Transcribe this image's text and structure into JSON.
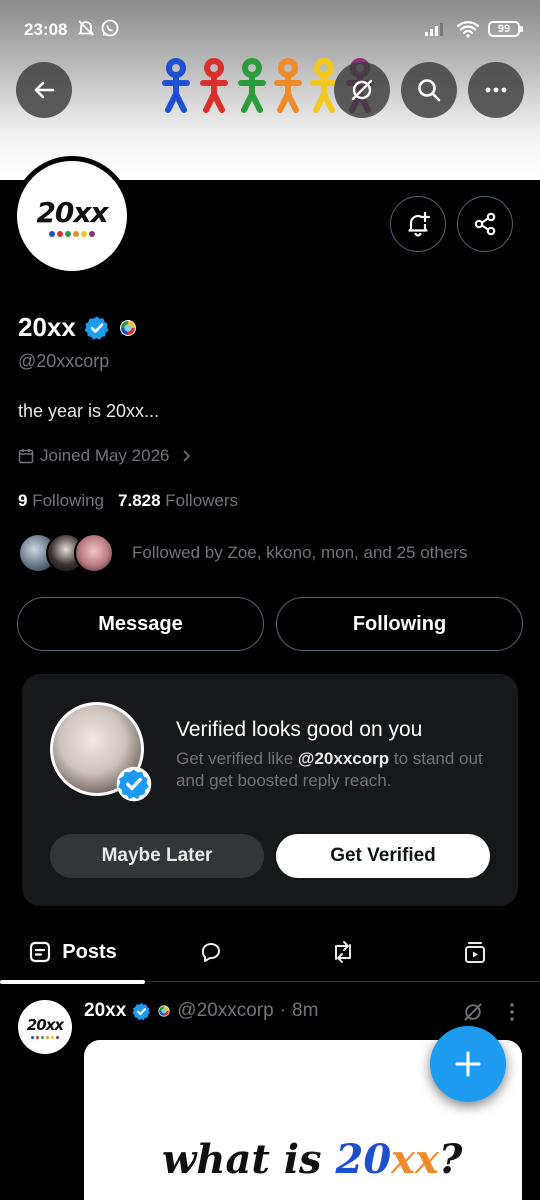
{
  "status_bar": {
    "time": "23:08",
    "battery": "99",
    "left_icons": [
      "mute-bell-icon",
      "whatsapp-icon"
    ],
    "right_icons": [
      "signal-icon",
      "wifi-icon",
      "battery-icon"
    ]
  },
  "header": {
    "icons": [
      "back-arrow-icon",
      "grok-icon",
      "search-icon",
      "more-icon"
    ]
  },
  "profile": {
    "logo_text": "20xx",
    "name": "20xx",
    "handle": "@20xxcorp",
    "bio": "the year is 20xx...",
    "joined": "Joined May 2026",
    "following_count": "9",
    "following_label": "Following",
    "followers_count": "7.828",
    "followers_label": "Followers",
    "followed_by": "Followed by Zoe, kkono, mon, and 25 others"
  },
  "actions": {
    "message_label": "Message",
    "following_label": "Following"
  },
  "verify_card": {
    "title": "Verified looks good on you",
    "sub_prefix": "Get verified like ",
    "sub_handle": "@20xxcorp",
    "sub_suffix": " to stand out and get boosted reply reach.",
    "maybe_label": "Maybe Later",
    "verify_label": "Get Verified"
  },
  "tabs": {
    "posts_label": "Posts",
    "icons": [
      "posts-icon",
      "replies-icon",
      "reposts-icon",
      "media-icon"
    ]
  },
  "post": {
    "name": "20xx",
    "handle": "@20xxcorp",
    "time": "8m",
    "media_text_1": "what is ",
    "media_text_2": "20",
    "media_text_3": "xx",
    "media_text_4": "?"
  },
  "colors": {
    "accent": "#1d9bf0",
    "background": "#000000",
    "muted_text": "#71767b",
    "card": "#16181c"
  }
}
